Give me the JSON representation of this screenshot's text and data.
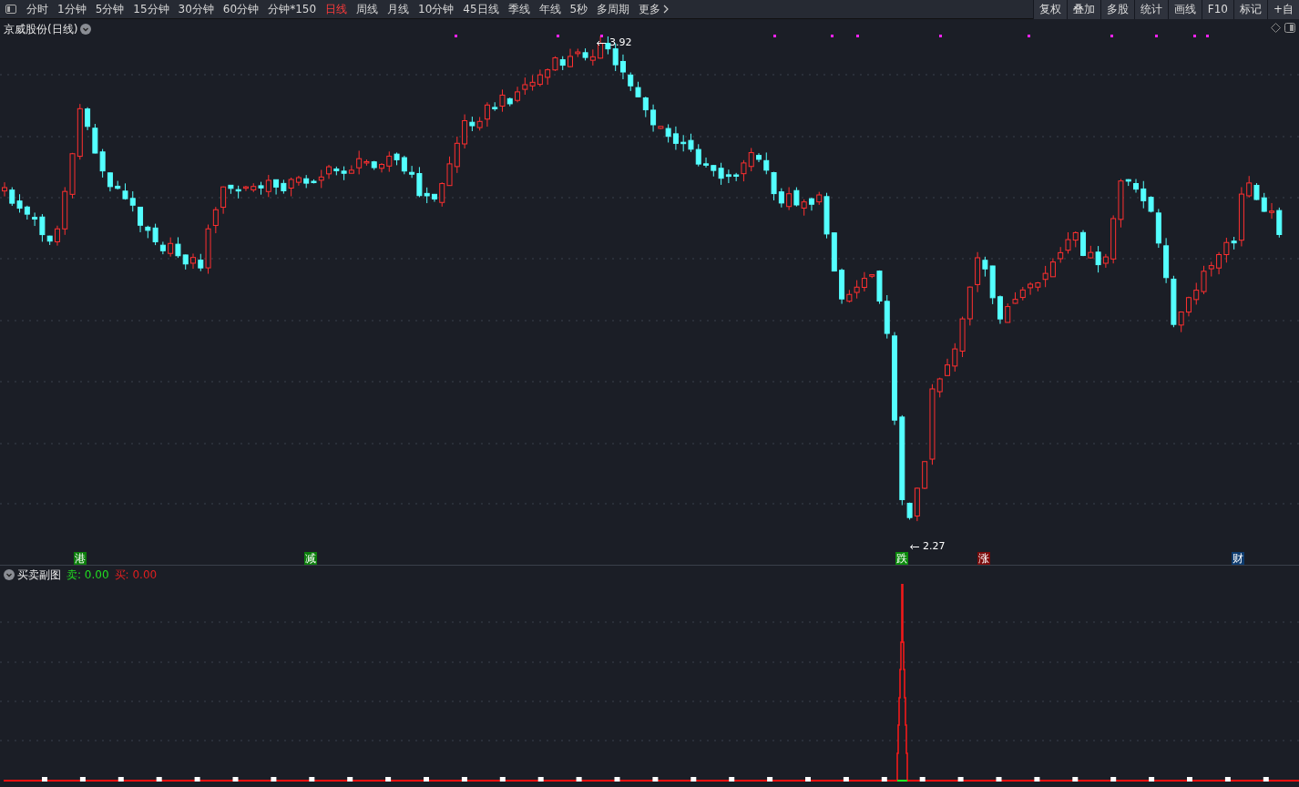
{
  "toolbar": {
    "periods": [
      {
        "label": "分时",
        "selected": false
      },
      {
        "label": "1分钟",
        "selected": false
      },
      {
        "label": "5分钟",
        "selected": false
      },
      {
        "label": "15分钟",
        "selected": false
      },
      {
        "label": "30分钟",
        "selected": false
      },
      {
        "label": "60分钟",
        "selected": false
      },
      {
        "label": "分钟*150",
        "selected": false
      },
      {
        "label": "日线",
        "selected": true
      },
      {
        "label": "周线",
        "selected": false
      },
      {
        "label": "月线",
        "selected": false
      },
      {
        "label": "10分钟",
        "selected": false
      },
      {
        "label": "45日线",
        "selected": false
      },
      {
        "label": "季线",
        "selected": false
      },
      {
        "label": "年线",
        "selected": false
      },
      {
        "label": "5秒",
        "selected": false
      },
      {
        "label": "多周期",
        "selected": false
      }
    ],
    "more": "更多",
    "tools": [
      "复权",
      "叠加",
      "多股",
      "统计",
      "画线",
      "F10",
      "标记",
      "+自"
    ]
  },
  "main_chart": {
    "title": "京威股份(日线)",
    "high_label": "3.92",
    "low_label": "2.27",
    "markers": [
      {
        "text": "港",
        "color": "#0b7d0b"
      },
      {
        "text": "减",
        "color": "#0b7d0b"
      },
      {
        "text": "跌",
        "color": "#0b8a0b"
      },
      {
        "text": "涨",
        "color": "#7a0a0a"
      },
      {
        "text": "财",
        "color": "#0d3b6e"
      }
    ]
  },
  "sub_chart": {
    "title": "买卖副图",
    "readings": [
      {
        "text": "卖: 0.00",
        "color": "#22dd22"
      },
      {
        "text": "买: 0.00",
        "color": "#e02020"
      }
    ]
  }
}
